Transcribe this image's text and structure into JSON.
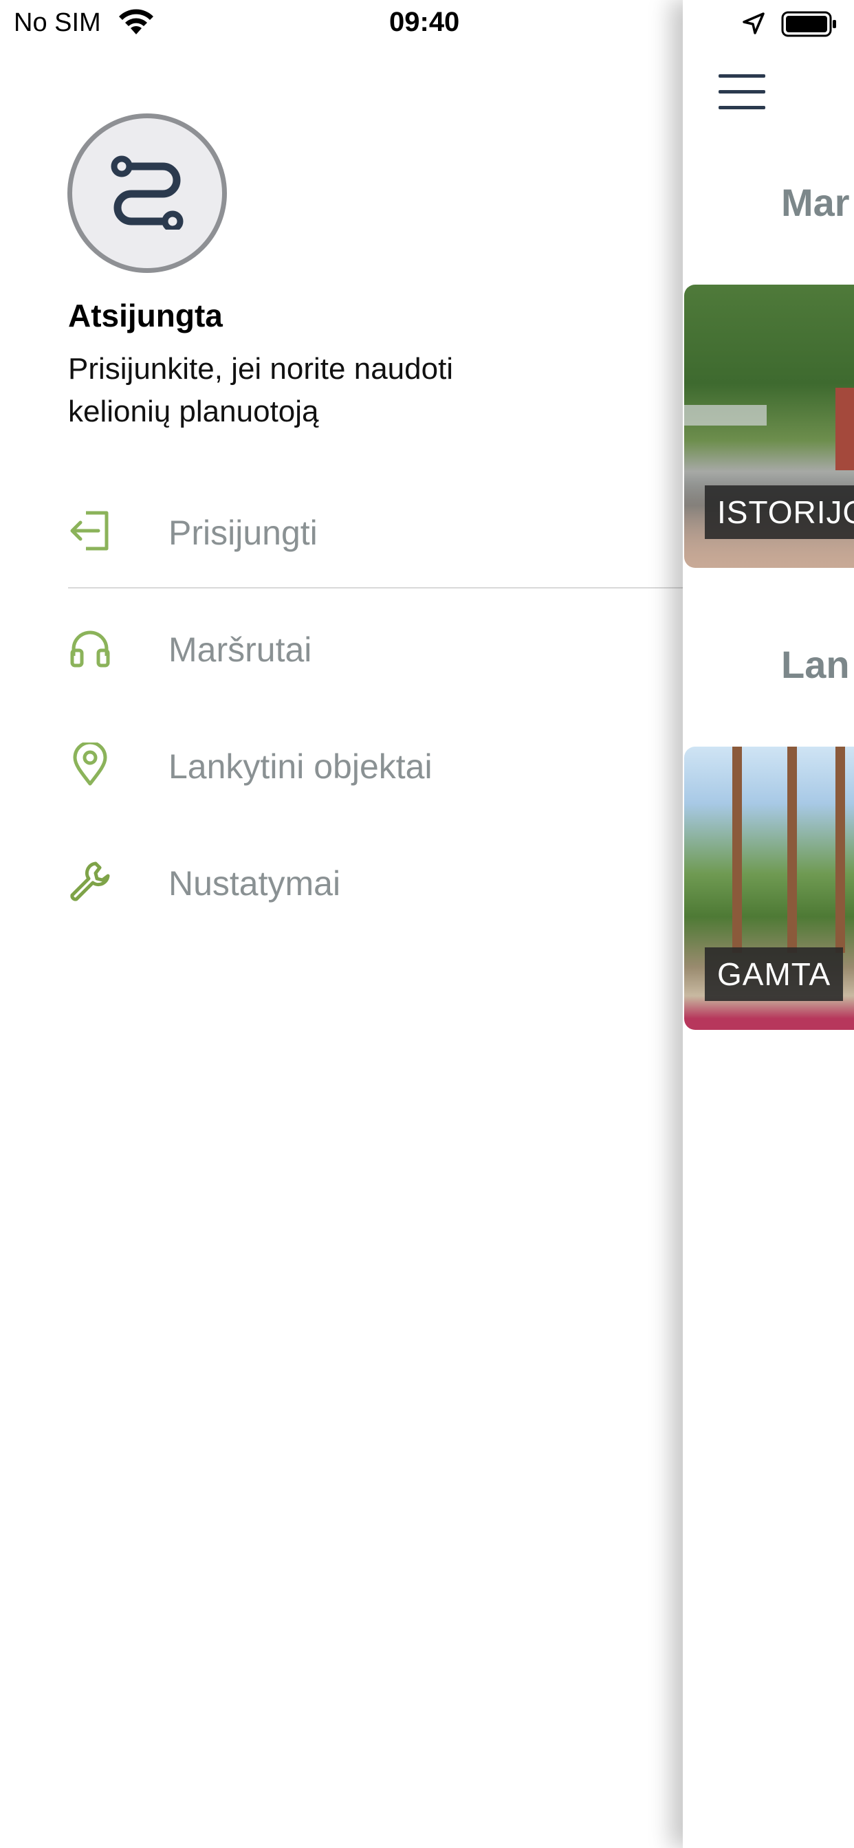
{
  "status_bar": {
    "carrier": "No SIM",
    "time": "09:40"
  },
  "drawer": {
    "user_name": "Atsijungta",
    "user_description": "Prisijunkite, jei norite naudoti kelionių planuotoją",
    "items": [
      {
        "label": "Prisijungti",
        "icon": "login-icon"
      },
      {
        "label": "Maršrutai",
        "icon": "headphones-icon"
      },
      {
        "label": "Lankytini objektai",
        "icon": "location-pin-icon"
      },
      {
        "label": "Nustatymai",
        "icon": "wrench-icon"
      }
    ]
  },
  "main": {
    "section_1_title": "Mar",
    "section_2_title": "Lan",
    "card_1_label": "ISTORIJO",
    "card_2_label": "GAMTA"
  },
  "colors": {
    "menu_icon_green": "#8bb35a",
    "menu_label_gray": "#8a9193",
    "section_title_gray": "#7c878a",
    "hamburger_navy": "#2b3a4e"
  }
}
